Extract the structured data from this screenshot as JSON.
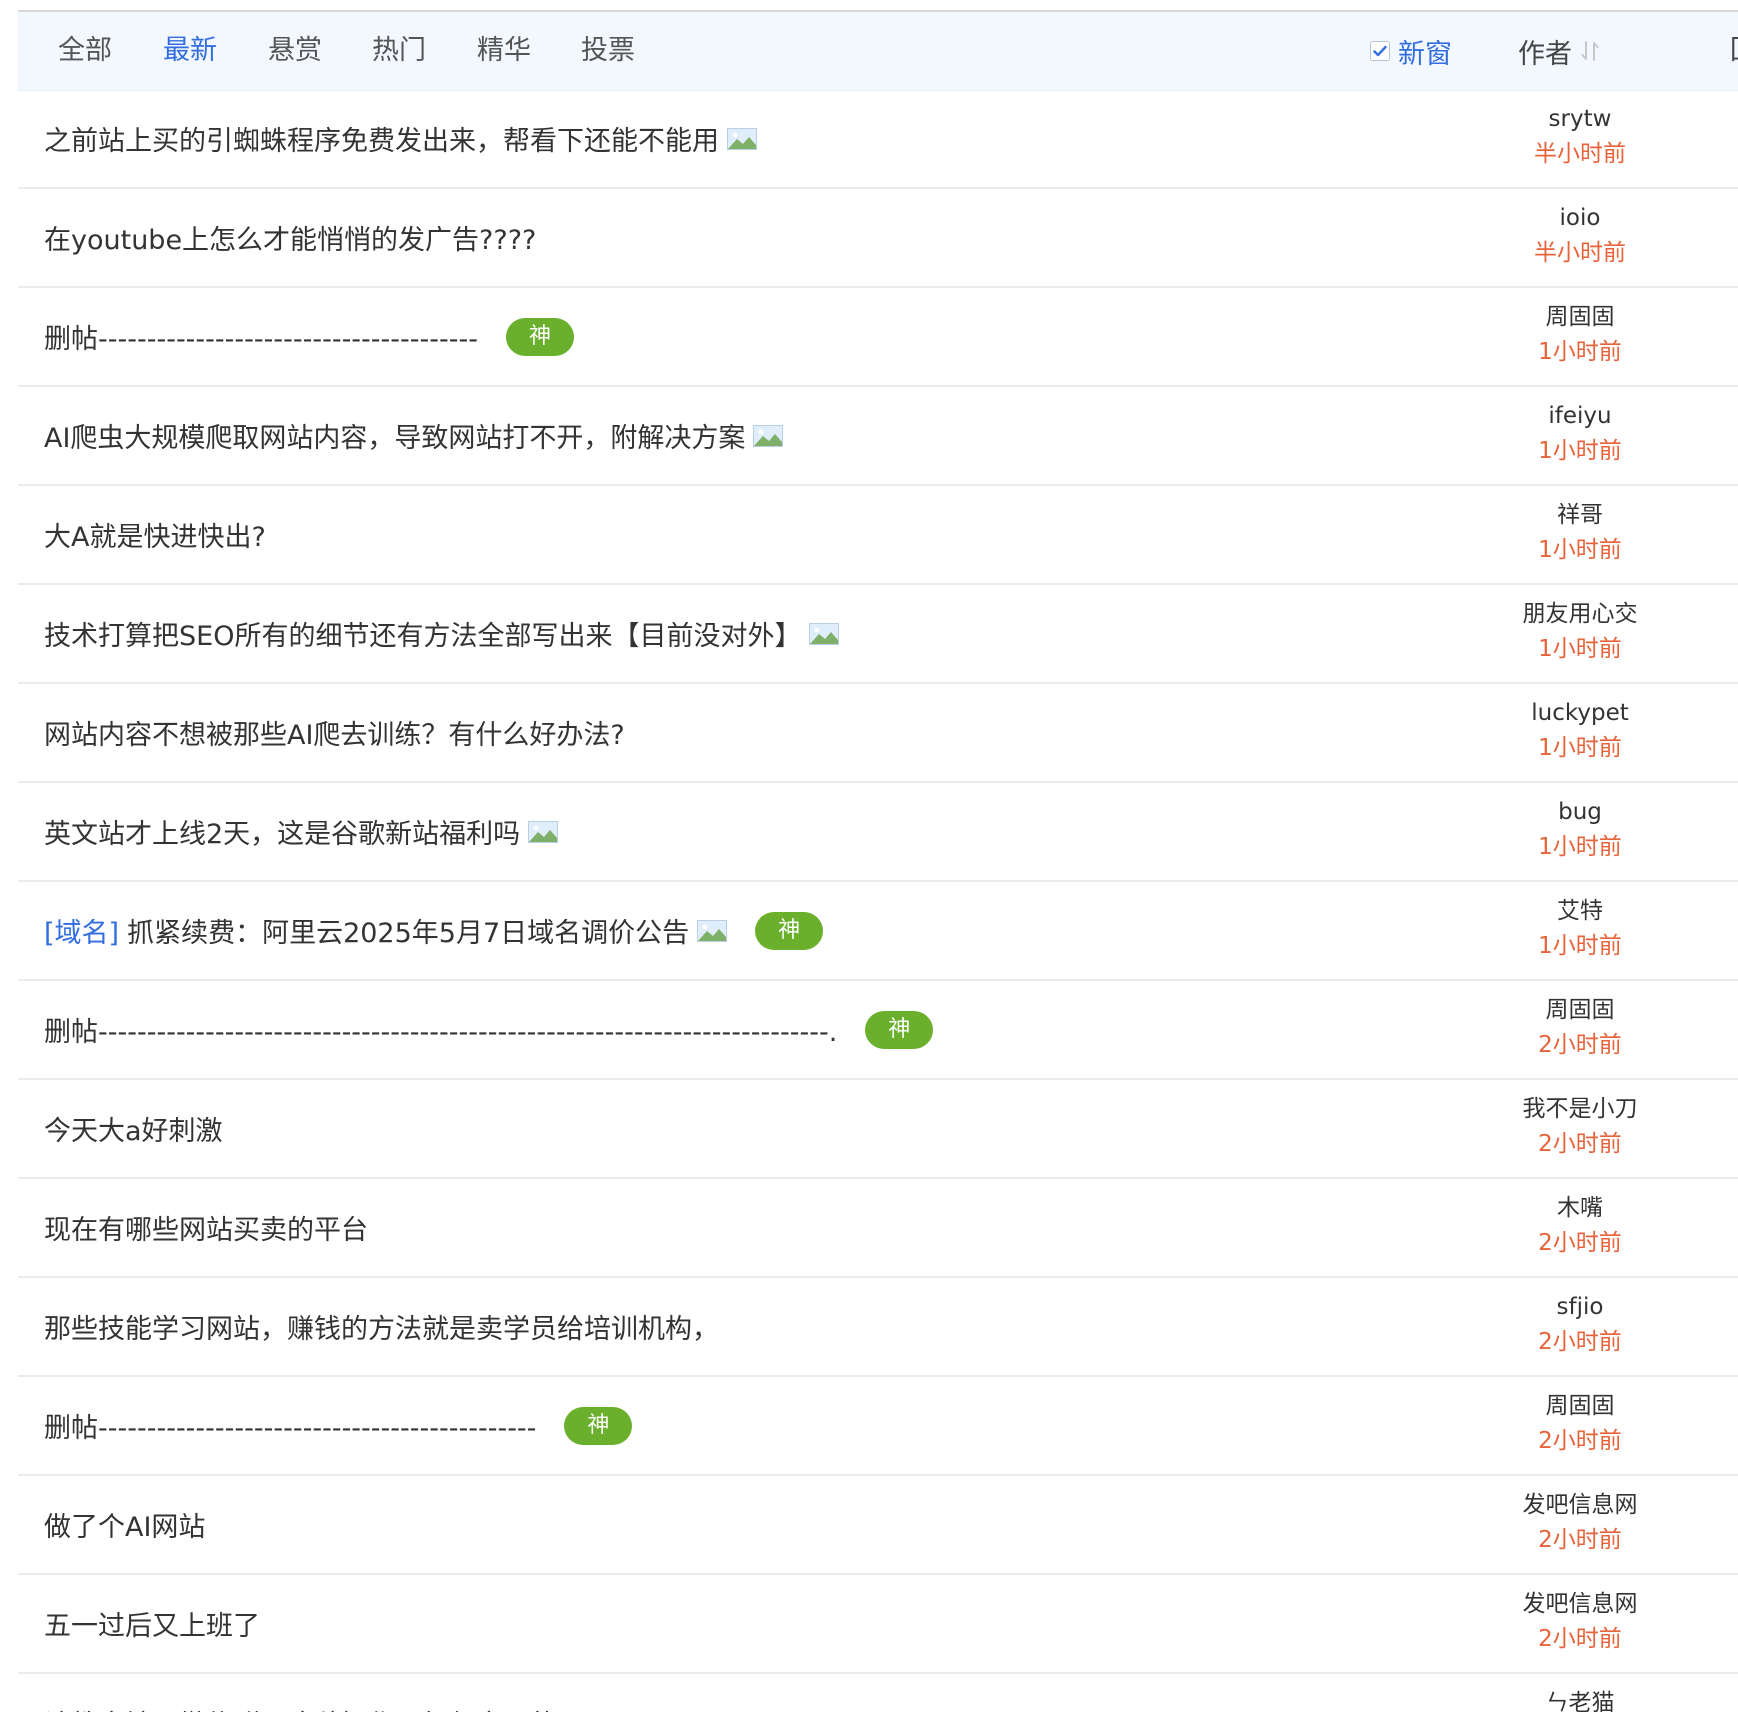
{
  "tabs": [
    {
      "label": "全部",
      "active": false
    },
    {
      "label": "最新",
      "active": true
    },
    {
      "label": "悬赏",
      "active": false
    },
    {
      "label": "热门",
      "active": false
    },
    {
      "label": "精华",
      "active": false
    },
    {
      "label": "投票",
      "active": false
    }
  ],
  "header": {
    "new_window_label": "新窗",
    "new_window_checked": true,
    "author_label": "作者",
    "reply_label": "回"
  },
  "colors": {
    "accent": "#336ee0",
    "time": "#e8633a",
    "badge": "#6bb02d",
    "bar_bg": "#f2f8fe"
  },
  "posts": [
    {
      "category": "",
      "title": "之前站上买的引蜘蛛程序免费发出来，帮看下还能不能用",
      "has_image": true,
      "badge": "",
      "author": "srytw",
      "time": "半小时前"
    },
    {
      "category": "",
      "title": "在youtube上怎么才能悄悄的发广告????",
      "has_image": false,
      "badge": "",
      "author": "ioio",
      "time": "半小时前"
    },
    {
      "category": "",
      "title": "删帖---------------------------------------",
      "has_image": false,
      "badge": "神",
      "author": "周固固",
      "time": "1小时前"
    },
    {
      "category": "",
      "title": "AI爬虫大规模爬取网站内容，导致网站打不开，附解决方案",
      "has_image": true,
      "badge": "",
      "author": "ifeiyu",
      "time": "1小时前"
    },
    {
      "category": "",
      "title": "大A就是快进快出?",
      "has_image": false,
      "badge": "",
      "author": "祥哥",
      "time": "1小时前"
    },
    {
      "category": "",
      "title": "技术打算把SEO所有的细节还有方法全部写出来【目前没对外】",
      "has_image": true,
      "badge": "",
      "author": "朋友用心交",
      "time": "1小时前"
    },
    {
      "category": "",
      "title": "网站内容不想被那些AI爬去训练？有什么好办法?",
      "has_image": false,
      "badge": "",
      "author": "luckypet",
      "time": "1小时前"
    },
    {
      "category": "",
      "title": "英文站才上线2天，这是谷歌新站福利吗",
      "has_image": true,
      "badge": "",
      "author": "bug",
      "time": "1小时前"
    },
    {
      "category": "[域名]",
      "title": "抓紧续费：阿里云2025年5月7日域名调价公告",
      "has_image": true,
      "badge": "神",
      "author": "艾特",
      "time": "1小时前"
    },
    {
      "category": "",
      "title": "删帖---------------------------------------------------------------------------.",
      "has_image": false,
      "badge": "神",
      "author": "周固固",
      "time": "2小时前"
    },
    {
      "category": "",
      "title": "今天大a好刺激",
      "has_image": false,
      "badge": "",
      "author": "我不是小刀",
      "time": "2小时前"
    },
    {
      "category": "",
      "title": "现在有哪些网站买卖的平台",
      "has_image": false,
      "badge": "",
      "author": "木嘴",
      "time": "2小时前"
    },
    {
      "category": "",
      "title": "那些技能学习网站，赚钱的方法就是卖学员给培训机构，",
      "has_image": false,
      "badge": "",
      "author": "sfjio",
      "time": "2小时前"
    },
    {
      "category": "",
      "title": "删帖---------------------------------------------",
      "has_image": false,
      "badge": "神",
      "author": "周固固",
      "time": "2小时前"
    },
    {
      "category": "",
      "title": "做了个AI网站",
      "has_image": false,
      "badge": "",
      "author": "发吧信息网",
      "time": "2小时前"
    },
    {
      "category": "",
      "title": "五一过后又上班了",
      "has_image": false,
      "badge": "",
      "author": "发吧信息网",
      "time": "2小时前"
    },
    {
      "category": "",
      "title": "请教大神，微信群里这种操作是如何实现的?",
      "has_image": true,
      "badge": "",
      "author": "ㄣ老猫",
      "time": ""
    }
  ]
}
